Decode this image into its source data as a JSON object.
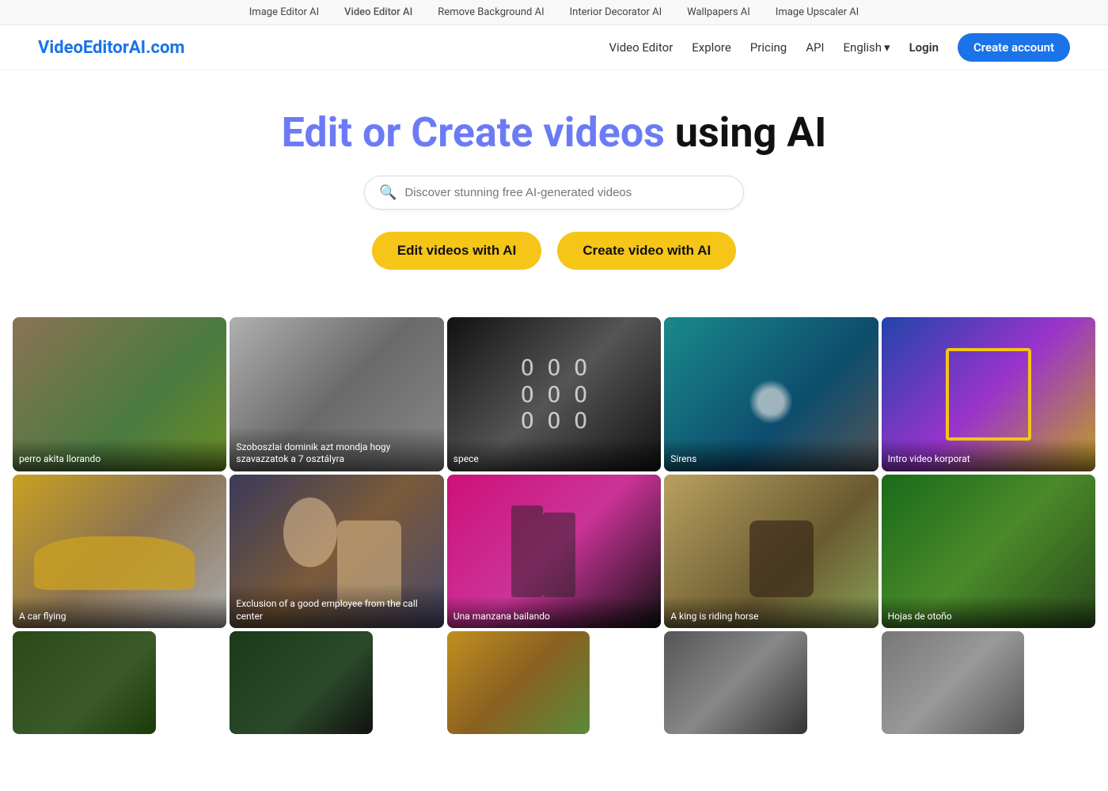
{
  "topbar": {
    "links": [
      {
        "label": "Image Editor AI",
        "id": "image-editor-ai",
        "active": false
      },
      {
        "label": "Video Editor AI",
        "id": "video-editor-ai",
        "active": true
      },
      {
        "label": "Remove Background AI",
        "id": "remove-bg-ai",
        "active": false
      },
      {
        "label": "Interior Decorator AI",
        "id": "interior-ai",
        "active": false
      },
      {
        "label": "Wallpapers AI",
        "id": "wallpapers-ai",
        "active": false
      },
      {
        "label": "Image Upscaler AI",
        "id": "upscaler-ai",
        "active": false
      }
    ]
  },
  "mainnav": {
    "logo": "VideoEditorAI.com",
    "links": [
      {
        "label": "Video Editor",
        "id": "nav-video-editor"
      },
      {
        "label": "Explore",
        "id": "nav-explore"
      },
      {
        "label": "Pricing",
        "id": "nav-pricing"
      },
      {
        "label": "API",
        "id": "nav-api"
      }
    ],
    "language": "English",
    "login": "Login",
    "create_account": "Create account"
  },
  "hero": {
    "title_part1": "Edit or ",
    "title_colored1": "Create videos",
    "title_part2": " using AI",
    "search_placeholder": "Discover stunning free AI-generated videos",
    "btn_edit": "Edit videos with AI",
    "btn_create": "Create video with AI"
  },
  "videos": {
    "row1": [
      {
        "label": "perro akita llorando",
        "thumb_class": "thumb-dog"
      },
      {
        "label": "Szoboszlai dominik azt mondja hogy szavazzatok a 7 osztályra",
        "thumb_class": "thumb-fight"
      },
      {
        "label": "spece",
        "thumb_class": "thumb-text"
      },
      {
        "label": "Sirens",
        "thumb_class": "thumb-sirens"
      },
      {
        "label": "Intro video korporat",
        "thumb_class": "thumb-korporat"
      }
    ],
    "row2": [
      {
        "label": "A car flying",
        "thumb_class": "thumb-car"
      },
      {
        "label": "Exclusion of a good employee from the call center",
        "thumb_class": "thumb-callcenter"
      },
      {
        "label": "Una manzana bailando",
        "thumb_class": "thumb-manzana"
      },
      {
        "label": "A king is riding horse",
        "thumb_class": "thumb-horse"
      },
      {
        "label": "Hojas de otoño",
        "thumb_class": "thumb-hojas"
      }
    ],
    "row3": [
      {
        "label": "",
        "thumb_class": "thumb-row3a"
      },
      {
        "label": "",
        "thumb_class": "thumb-row3b"
      },
      {
        "label": "",
        "thumb_class": "thumb-row3c"
      },
      {
        "label": "",
        "thumb_class": "thumb-row3d"
      },
      {
        "label": "",
        "thumb_class": "thumb-row3e"
      }
    ]
  }
}
